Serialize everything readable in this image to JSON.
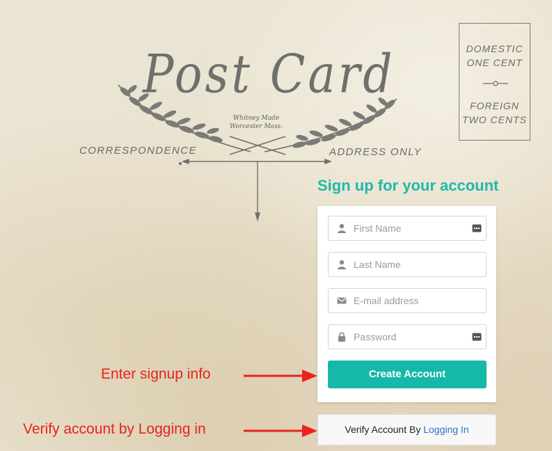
{
  "postcard": {
    "title": "Post Card",
    "maker_line1": "Whitney Made",
    "maker_line2": "Worcester Mass.",
    "correspondence_label": "CORRESPONDENCE",
    "address_label": "ADDRESS ONLY",
    "stamp": {
      "domestic_line1": "DOMESTIC",
      "domestic_line2": "ONE CENT",
      "foreign_line1": "FOREIGN",
      "foreign_line2": "TWO CENTS"
    }
  },
  "signup": {
    "heading": "Sign up for your account",
    "fields": {
      "first_name": {
        "placeholder": "First Name",
        "value": "",
        "icon": "user-icon"
      },
      "last_name": {
        "placeholder": "Last Name",
        "value": "",
        "icon": "user-icon"
      },
      "email": {
        "placeholder": "E-mail address",
        "value": "",
        "icon": "envelope-icon"
      },
      "password": {
        "placeholder": "Password",
        "value": "",
        "icon": "lock-icon"
      }
    },
    "create_button_label": "Create Account",
    "verify_prefix": "Verify Account By",
    "verify_link_label": "Logging In"
  },
  "annotations": {
    "signup_note": "Enter signup info",
    "verify_note": "Verify account by Logging in",
    "color": "#e8231c"
  },
  "colors": {
    "accent": "#16b8aa",
    "heading": "#22b8a8",
    "link": "#2a6fc9"
  }
}
